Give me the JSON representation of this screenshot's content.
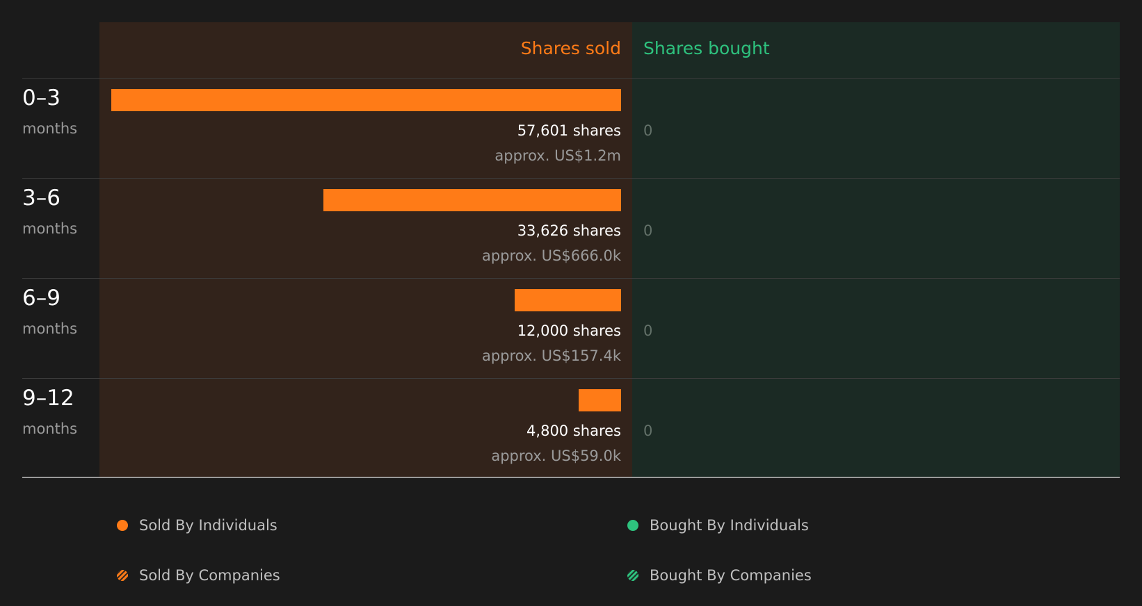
{
  "colors": {
    "sold": "#ff7b17",
    "bought": "#2ec27e",
    "sold_bg": "#32231b",
    "bought_bg": "#1b2a24",
    "background": "#1b1b1b"
  },
  "headers": {
    "sold": "Shares sold",
    "bought": "Shares bought"
  },
  "chart_data": {
    "type": "bar",
    "categories": [
      "0–3 months",
      "3–6 months",
      "6–9 months",
      "9–12 months"
    ],
    "series": [
      {
        "name": "Shares sold",
        "values": [
          57601,
          33626,
          12000,
          4800
        ]
      },
      {
        "name": "Shares bought",
        "values": [
          0,
          0,
          0,
          0
        ]
      }
    ]
  },
  "rows": [
    {
      "period": "0–3",
      "unit": "months",
      "shares_label": "57,601 shares",
      "value_label": "approx. US$1.2m",
      "bought_label": "0"
    },
    {
      "period": "3–6",
      "unit": "months",
      "shares_label": "33,626 shares",
      "value_label": "approx. US$666.0k",
      "bought_label": "0"
    },
    {
      "period": "6–9",
      "unit": "months",
      "shares_label": "12,000 shares",
      "value_label": "approx. US$157.4k",
      "bought_label": "0"
    },
    {
      "period": "9–12",
      "unit": "months",
      "shares_label": "4,800 shares",
      "value_label": "approx. US$59.0k",
      "bought_label": "0"
    }
  ],
  "legend": [
    {
      "label": "Sold By Individuals",
      "icon": "filled-orange-dot"
    },
    {
      "label": "Bought By Individuals",
      "icon": "filled-green-dot"
    },
    {
      "label": "Sold By Companies",
      "icon": "hatched-orange-dot"
    },
    {
      "label": "Bought By Companies",
      "icon": "hatched-green-dot"
    }
  ]
}
